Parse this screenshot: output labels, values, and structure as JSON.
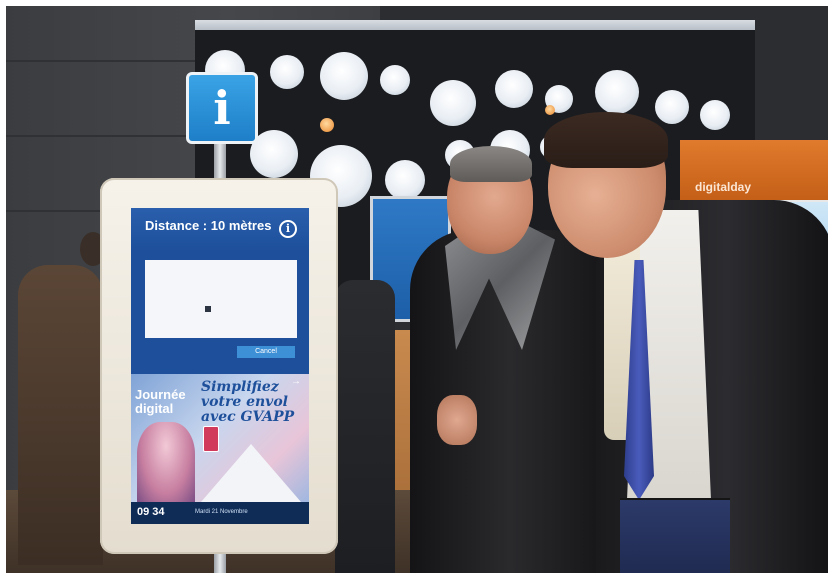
{
  "info_sign": {
    "glyph": "i"
  },
  "kiosk": {
    "distance_label": "Distance : 10 mètres",
    "info_icon_glyph": "i",
    "cancel_label": "Cancel",
    "promo": {
      "journee": "Journée digital",
      "simplifiez": "Simplifiez votre envol avec GVAPP",
      "arrow": "→"
    },
    "clock": "09 34",
    "date": "Mardi 21 Novembre"
  },
  "background": {
    "sign_text": "digitalday"
  },
  "colors": {
    "info_blue": "#1e7fc8",
    "kiosk_screen_blue": "#1d4f9a",
    "sign_orange": "#e07a2c",
    "tie_blue": "#3a4ca8"
  }
}
